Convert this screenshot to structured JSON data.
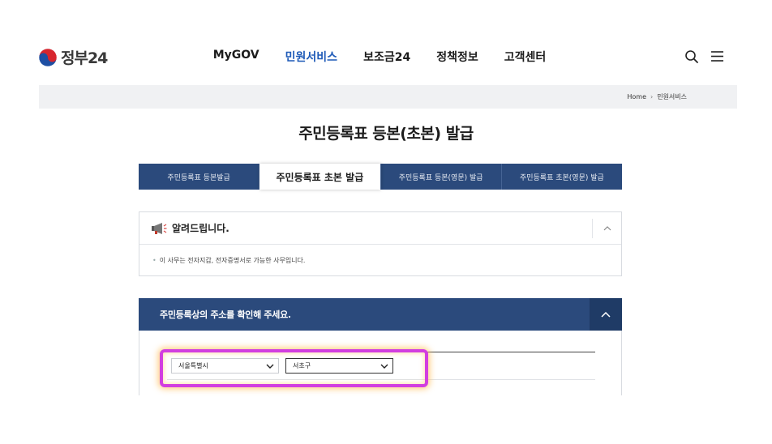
{
  "header": {
    "logo_text": "정부24",
    "nav": [
      "MyGOV",
      "민원서비스",
      "보조금24",
      "정책정보",
      "고객센터"
    ],
    "active_nav_index": 1,
    "search_icon": "search-icon",
    "menu_icon": "hamburger-menu-icon"
  },
  "breadcrumb": {
    "home": "Home",
    "current": "민원서비스"
  },
  "page": {
    "title": "주민등록표 등본(초본) 발급"
  },
  "tabs": [
    {
      "label": "주민등록표 등본발급",
      "active": false
    },
    {
      "label": "주민등록표 초본 발급",
      "active": true
    },
    {
      "label": "주민등록표 등본(영문) 발급",
      "active": false
    },
    {
      "label": "주민등록표 초본(영문) 발급",
      "active": false
    }
  ],
  "notice": {
    "icon": "megaphone-icon",
    "title": "알려드립니다.",
    "body": "이 사무는 전자지갑, 전자증명서로 가능한 사무입니다."
  },
  "address_section": {
    "title": "주민등록상의 주소를 확인해 주세요.",
    "sido_selected": "서울특별시",
    "sigungu_selected": "서초구"
  },
  "colors": {
    "brand_navy": "#2b4a7c",
    "active_nav": "#1f5bb8",
    "highlight": "#d23ee0"
  }
}
